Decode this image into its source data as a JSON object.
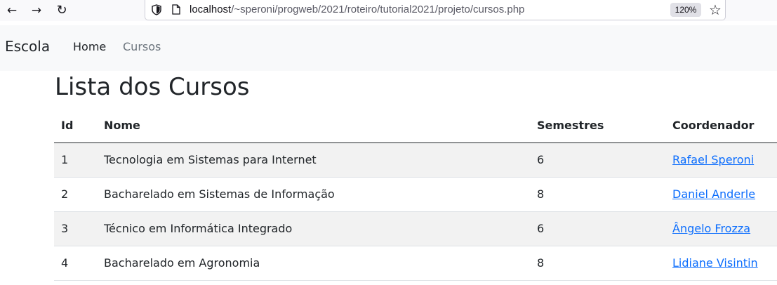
{
  "browser": {
    "back_icon": "arrow-left-icon",
    "forward_icon": "arrow-right-icon",
    "reload_icon": "reload-icon",
    "url_host": "localhost",
    "url_path": "/~speroni/progweb/2021/roteiro/tutorial2021/projeto/cursos.php",
    "zoom": "120%",
    "bookmark_icon": "star-icon"
  },
  "navbar": {
    "brand": "Escola",
    "links": [
      {
        "label": "Home"
      },
      {
        "label": "Cursos"
      }
    ]
  },
  "main": {
    "title": "Lista dos Cursos",
    "table": {
      "headers": [
        "Id",
        "Nome",
        "Semestres",
        "Coordenador"
      ],
      "rows": [
        {
          "id": "1",
          "nome": "Tecnologia em Sistemas para Internet",
          "semestres": "6",
          "coordenador": "Rafael Speroni"
        },
        {
          "id": "2",
          "nome": "Bacharelado em Sistemas de Informação",
          "semestres": "8",
          "coordenador": "Daniel Anderle"
        },
        {
          "id": "3",
          "nome": "Técnico em Informática Integrado",
          "semestres": "6",
          "coordenador": "Ângelo Frozza"
        },
        {
          "id": "4",
          "nome": "Bacharelado em Agronomia",
          "semestres": "8",
          "coordenador": "Lidiane Visintin"
        }
      ]
    }
  },
  "colors": {
    "link": "#0d6efd",
    "navbar_bg": "#f8f9fa",
    "stripe": "#f2f2f2",
    "text": "#212529",
    "muted": "#6c757d"
  }
}
